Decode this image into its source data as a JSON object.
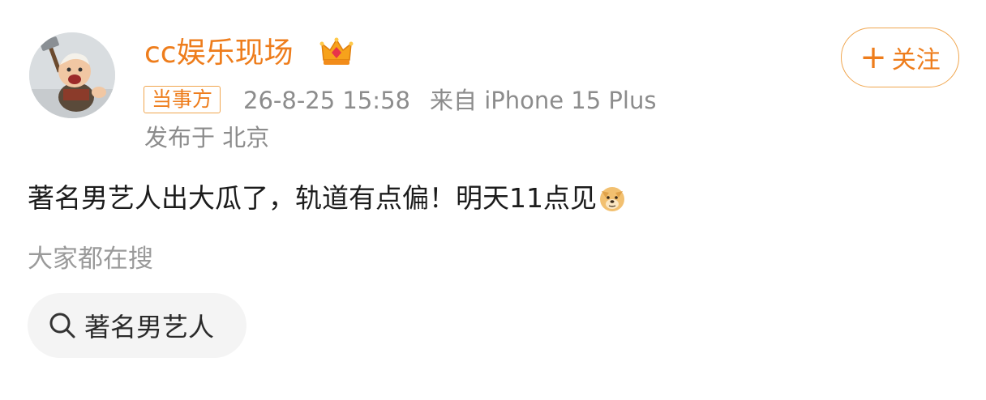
{
  "user": {
    "name": "cc娱乐现场",
    "badge": "当事方",
    "timestamp": "26-8-25 15:58",
    "source": "来自 iPhone 15 Plus",
    "location": "发布于 北京"
  },
  "follow_button": {
    "plus": "+",
    "label": "关注"
  },
  "post": {
    "text": "著名男艺人出大瓜了，轨道有点偏！明天11点见"
  },
  "search": {
    "title": "大家都在搜",
    "chip_label": "著名男艺人"
  },
  "icons": {
    "crown": "crown-icon",
    "emoji": "doge-emoji-icon",
    "search": "search-icon"
  },
  "colors": {
    "accent": "#ee7d1c",
    "accent_border": "#f0a64f",
    "meta_text": "#8c8c8c",
    "chip_bg": "#f4f4f4"
  }
}
